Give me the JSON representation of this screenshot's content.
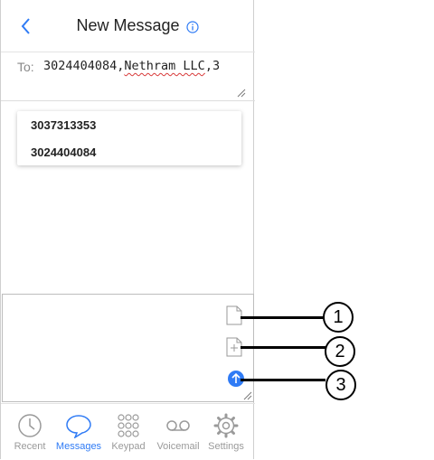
{
  "header": {
    "title": "New Message"
  },
  "recipients": {
    "to_label": "To:",
    "value_plain": "3024404084,",
    "value_flagged": "Nethram LLC",
    "value_tail": ",3"
  },
  "suggestions": [
    "3037313353",
    "3024404084"
  ],
  "tabs": [
    {
      "label": "Recent",
      "icon": "clock-icon",
      "active": false
    },
    {
      "label": "Messages",
      "icon": "chat-bubble-icon",
      "active": true
    },
    {
      "label": "Keypad",
      "icon": "keypad-icon",
      "active": false
    },
    {
      "label": "Voicemail",
      "icon": "voicemail-icon",
      "active": false
    },
    {
      "label": "Settings",
      "icon": "gear-icon",
      "active": false
    }
  ],
  "annotations": [
    "1",
    "2",
    "3"
  ],
  "colors": {
    "accent": "#2f7bf5",
    "inactive": "#9a9a9a"
  }
}
